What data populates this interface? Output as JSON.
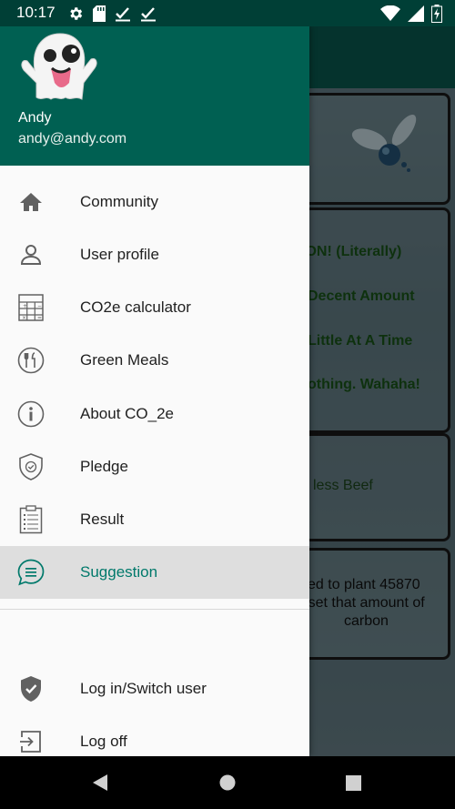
{
  "status_bar": {
    "time": "10:17"
  },
  "user": {
    "name": "Andy",
    "email": "andy@andy.com"
  },
  "menu": [
    {
      "label": "Community",
      "icon": "home-icon"
    },
    {
      "label": "User profile",
      "icon": "person-icon"
    },
    {
      "label": "CO2e calculator",
      "icon": "calculator-icon"
    },
    {
      "label": "Green Meals",
      "icon": "utensils-icon"
    },
    {
      "label": "About CO_2e",
      "icon": "info-icon"
    },
    {
      "label": "Pledge",
      "icon": "shield-check-icon"
    },
    {
      "label": "Result",
      "icon": "clipboard-icon"
    },
    {
      "label": "Suggestion",
      "icon": "chat-icon",
      "active": true
    }
  ],
  "bottom_menu": [
    {
      "label": "Log in/Switch user",
      "icon": "shield-check-filled-icon"
    },
    {
      "label": "Log off",
      "icon": "logout-icon"
    }
  ],
  "background": {
    "options": [
      "TON! (Literally)",
      "Decent Amount",
      "Little At A Time",
      "othing. Wahaha!"
    ],
    "suggestion": "less Beef",
    "result_line1": "ed to plant 45870",
    "result_line2": "ffset that amount of",
    "result_line3": "carbon"
  },
  "colors": {
    "primary": "#006052",
    "accent": "#00796b",
    "status_bar": "#003f36"
  }
}
